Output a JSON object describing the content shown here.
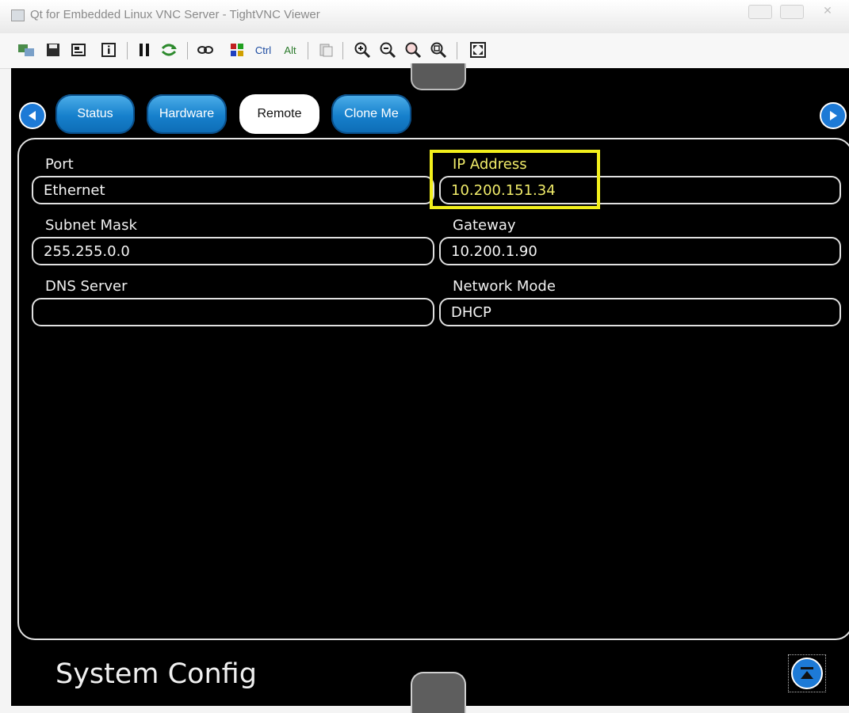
{
  "window": {
    "title": "Qt for Embedded Linux VNC Server - TightVNC Viewer"
  },
  "toolbar": {
    "ctrl_label": "Ctrl",
    "alt_label": "Alt",
    "icons": [
      "new-connection-icon",
      "save-icon",
      "options-icon",
      "info-icon",
      "pause-icon",
      "refresh-icon",
      "ctrl-alt-del-icon",
      "ctrl-esc-icon",
      "clipboard-icon",
      "zoom-in-icon",
      "zoom-out-icon",
      "zoom-100-icon",
      "zoom-fit-icon",
      "fullscreen-icon"
    ]
  },
  "tabs": [
    {
      "label": "Status",
      "active": false
    },
    {
      "label": "Hardware",
      "active": false
    },
    {
      "label": "Remote",
      "active": true
    },
    {
      "label": "Clone Me",
      "active": false
    }
  ],
  "fields": {
    "port": {
      "label": "Port",
      "value": "Ethernet"
    },
    "ip_address": {
      "label": "IP Address",
      "value": "10.200.151.34"
    },
    "subnet_mask": {
      "label": "Subnet Mask",
      "value": "255.255.0.0"
    },
    "gateway": {
      "label": "Gateway",
      "value": "10.200.1.90"
    },
    "dns_server": {
      "label": "DNS Server",
      "value": ""
    },
    "network_mode": {
      "label": "Network Mode",
      "value": "DHCP"
    }
  },
  "screen_title": "System Config",
  "colors": {
    "tab_blue": "#1680cc",
    "highlight": "#f2ef1c",
    "highlight_text": "#f1ec6a",
    "screen_bg": "#000000"
  }
}
